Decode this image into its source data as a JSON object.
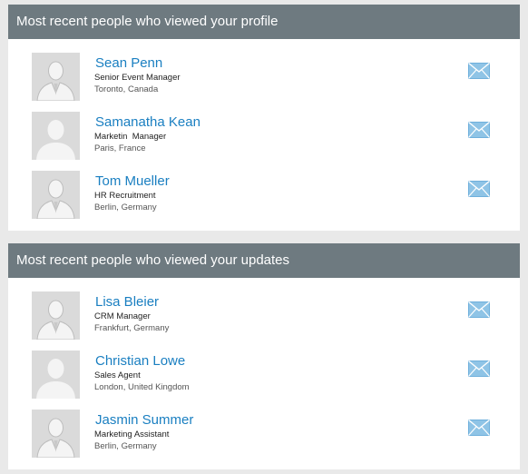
{
  "profile_views": {
    "heading": "Most recent people who viewed your profile",
    "people": [
      {
        "name": "Sean Penn",
        "title": "Senior Event Manager",
        "location": "Toronto, Canada",
        "avatar": "male-suit-silhouette"
      },
      {
        "name": "Samanatha Kean",
        "title": "Marketin  Manager",
        "location": "Paris, France",
        "avatar": "person-silhouette"
      },
      {
        "name": "Tom Mueller",
        "title": "HR Recruitment",
        "location": "Berlin, Germany",
        "avatar": "male-suit-silhouette"
      }
    ]
  },
  "update_views": {
    "heading": "Most recent people who viewed your updates",
    "people": [
      {
        "name": "Lisa Bleier",
        "title": "CRM Manager",
        "location": "Frankfurt, Germany",
        "avatar": "male-suit-silhouette"
      },
      {
        "name": "Christian Lowe",
        "title": "Sales Agent",
        "location": "London, United Kingdom",
        "avatar": "person-silhouette"
      },
      {
        "name": "Jasmin Summer",
        "title": "Marketing Assistant",
        "location": "Berlin, Germany",
        "avatar": "male-suit-silhouette"
      }
    ]
  },
  "colors": {
    "header_bg": "#6e7a80",
    "name_link": "#1a7fc1",
    "mail_icon": "#8fc4e6",
    "page_bg": "#e9e9e9"
  },
  "icons": {
    "message": "envelope-icon"
  }
}
